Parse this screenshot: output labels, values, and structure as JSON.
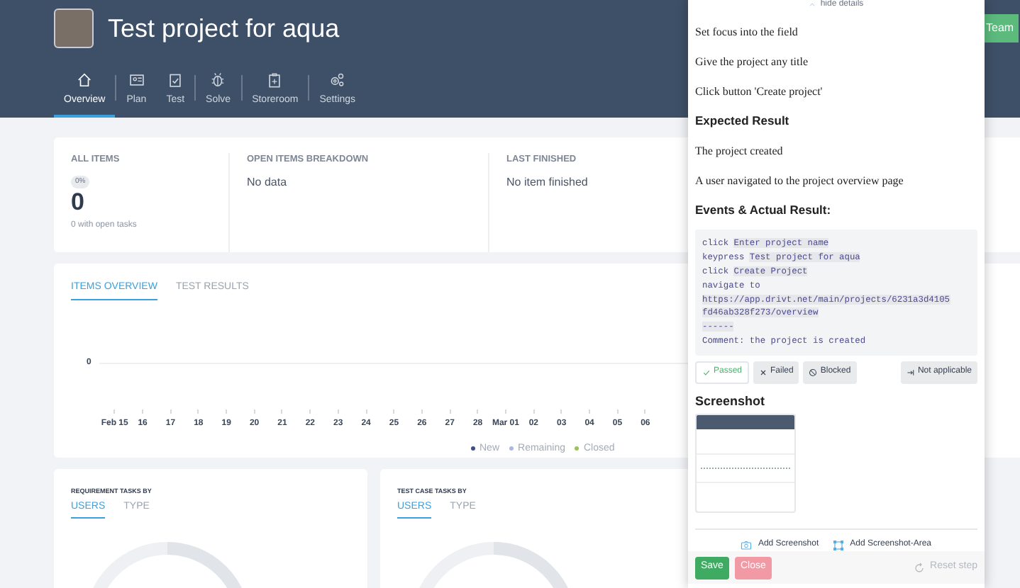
{
  "project": {
    "title": "Test project for aqua"
  },
  "nav": [
    {
      "label": "Overview",
      "selected": true
    },
    {
      "label": "Plan",
      "selected": false
    },
    {
      "label": "Test",
      "selected": false
    },
    {
      "label": "Solve",
      "selected": false
    },
    {
      "label": "Storeroom",
      "selected": false
    },
    {
      "label": "Settings",
      "selected": false
    }
  ],
  "team_button": "Team",
  "stats": {
    "all_items": {
      "label": "ALL ITEMS",
      "badge": "0%",
      "value": "0",
      "note": "0 with open tasks"
    },
    "open_items": {
      "label": "OPEN ITEMS BREAKDOWN",
      "value": "No data"
    },
    "last_finished": {
      "label": "LAST FINISHED",
      "value": "No item finished"
    }
  },
  "overview_tabs": [
    {
      "label": "ITEMS OVERVIEW",
      "selected": true
    },
    {
      "label": "TEST RESULTS",
      "selected": false
    }
  ],
  "timeline": {
    "y_tick": "0",
    "x_labels": [
      "Feb 15",
      "16",
      "17",
      "18",
      "19",
      "20",
      "21",
      "22",
      "23",
      "24",
      "25",
      "26",
      "27",
      "28",
      "Mar 01",
      "02",
      "03",
      "04",
      "05",
      "06"
    ],
    "legend": [
      {
        "label": "New",
        "color": "#3d4f8a"
      },
      {
        "label": "Remaining",
        "color": "#a9b8e0"
      },
      {
        "label": "Closed",
        "color": "#9bc25b"
      }
    ]
  },
  "task_cards": [
    {
      "title": "REQUIREMENT TASKS BY",
      "tabs": [
        {
          "label": "USERS",
          "selected": true
        },
        {
          "label": "TYPE",
          "selected": false
        }
      ]
    },
    {
      "title": "TEST CASE TASKS BY",
      "tabs": [
        {
          "label": "USERS",
          "selected": true
        },
        {
          "label": "TYPE",
          "selected": false
        }
      ]
    }
  ],
  "details": {
    "hide_link": "hide details",
    "steps": [
      "Set focus into the field",
      "Give the project any title",
      "Click button 'Create project'"
    ],
    "expected_heading": "Expected Result",
    "expected": [
      "The project created",
      "A user navigated to the project overview page"
    ],
    "events_heading": "Events & Actual Result:",
    "events": [
      [
        {
          "text": "click ",
          "highlighted": false
        },
        {
          "text": "Enter project name",
          "highlighted": true
        }
      ],
      [
        {
          "text": "keypress ",
          "highlighted": false
        },
        {
          "text": "Test project for aqua",
          "highlighted": true
        }
      ],
      [
        {
          "text": "click ",
          "highlighted": false
        },
        {
          "text": "Create Project",
          "highlighted": true
        }
      ],
      [
        {
          "text": "navigate to",
          "highlighted": false
        }
      ],
      [
        {
          "text": "https://app.drivt.net/main/projects/6231a3d4105",
          "highlighted": true
        }
      ],
      [
        {
          "text": "fd46ab328f273/overview",
          "highlighted": true
        }
      ],
      [
        {
          "text": "------",
          "highlighted": true
        }
      ],
      [
        {
          "text": "Comment: the project is created",
          "highlighted": false
        }
      ]
    ],
    "results": [
      {
        "label": "Passed",
        "selected": true
      },
      {
        "label": "Failed",
        "selected": false
      },
      {
        "label": "Blocked",
        "selected": false
      },
      {
        "label": "Not applicable",
        "selected": false
      }
    ],
    "screenshot_heading": "Screenshot",
    "add_screenshot": "Add Screenshot",
    "add_area": "Add Screenshot-Area",
    "save": "Save",
    "close": "Close",
    "reset": "Reset step"
  }
}
